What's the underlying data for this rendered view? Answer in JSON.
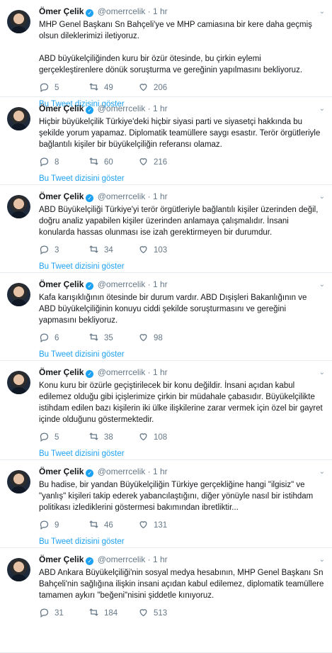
{
  "tweets": [
    {
      "name": "Ömer Çelik",
      "handle": "@omerrcelik",
      "time": "1 hr",
      "text": "MHP Genel Başkanı Sn Bahçeli'ye ve MHP camiasına bir kere daha geçmiş olsun dileklerimizi iletiyoruz.\n\nABD büyükelçiliğinden kuru bir özür ötesinde, bu çirkin eylemi gerçekleştirenlere dönük soruşturma ve gereğinin yapılmasını bekliyoruz.",
      "replies": "5",
      "retweets": "49",
      "likes": "206",
      "thread": "Bu Tweet dizisini göster"
    },
    {
      "name": "Ömer Çelik",
      "handle": "@omerrcelik",
      "time": "1 hr",
      "text": "Hiçbir büyükelçilik Türkiye'deki hiçbir siyasi parti ve siyasetçi hakkında bu şekilde yorum yapamaz. Diplomatik teamüllere saygı esastır. Terör örgütleriyle bağlantılı kişiler bir büyükelçiliğin referansı olamaz.",
      "replies": "8",
      "retweets": "60",
      "likes": "216",
      "thread": "Bu Tweet dizisini göster"
    },
    {
      "name": "Ömer Çelik",
      "handle": "@omerrcelik",
      "time": "1 hr",
      "text": "ABD Büyükelçiliği Türkiye'yi terör örgütleriyle bağlantılı kişiler üzerinden değil, doğru analiz yapabilen kişiler üzerinden anlamaya çalışmalıdır. İnsani konularda hassas olunması ise izah gerektirmeyen bir durumdur.",
      "replies": "3",
      "retweets": "34",
      "likes": "103",
      "thread": "Bu Tweet dizisini göster"
    },
    {
      "name": "Ömer Çelik",
      "handle": "@omerrcelik",
      "time": "1 hr",
      "text": "Kafa karışıklığının ötesinde bir durum vardır. ABD Dışişleri Bakanlığının ve ABD büyükelçiliğinin konuyu ciddi şekilde soruşturmasını ve gereğini yapmasını bekliyoruz.",
      "replies": "6",
      "retweets": "35",
      "likes": "98",
      "thread": "Bu Tweet dizisini göster"
    },
    {
      "name": "Ömer Çelik",
      "handle": "@omerrcelik",
      "time": "1 hr",
      "text": "Konu kuru bir özürle geçiştirilecek bir konu değildir. İnsani açıdan kabul edilemez olduğu gibi içişlerimize çirkin bir müdahale çabasıdır. Büyükelçilikte istihdam edilen bazı kişilerin iki ülke ilişkilerine zarar vermek için özel bir gayret içinde olduğunu göstermektedir.",
      "replies": "5",
      "retweets": "38",
      "likes": "108",
      "thread": "Bu Tweet dizisini göster"
    },
    {
      "name": "Ömer Çelik",
      "handle": "@omerrcelik",
      "time": "1 hr",
      "text": "Bu hadise, bir yandan Büyükelçiliğin Türkiye gerçekliğine hangi \"ilgisiz\" ve \"yanlış\" kişileri takip ederek yabancılaştığını, diğer yönüyle nasıl bir istihdam politikası izlediklerini göstermesi bakımından ibretliktir...",
      "replies": "9",
      "retweets": "46",
      "likes": "131",
      "thread": "Bu Tweet dizisini göster"
    },
    {
      "name": "Ömer Çelik",
      "handle": "@omerrcelik",
      "time": "1 hr",
      "text": "ABD Ankara Büyükelçiliği'nin sosyal medya hesabının, MHP Genel Başkanı Sn Bahçeli'nin sağlığına ilişkin insani açıdan kabul edilemez, diplomatik teamüllere tamamen aykırı \"beğeni\"nisini şiddetle kınıyoruz.",
      "replies": "31",
      "retweets": "184",
      "likes": "513",
      "thread": ""
    }
  ],
  "ui": {
    "dot": "·",
    "caret": "⌄",
    "verified_glyph": "✓"
  },
  "colors": {
    "link": "#1da1f2",
    "muted": "#657786",
    "text": "#14171a"
  }
}
